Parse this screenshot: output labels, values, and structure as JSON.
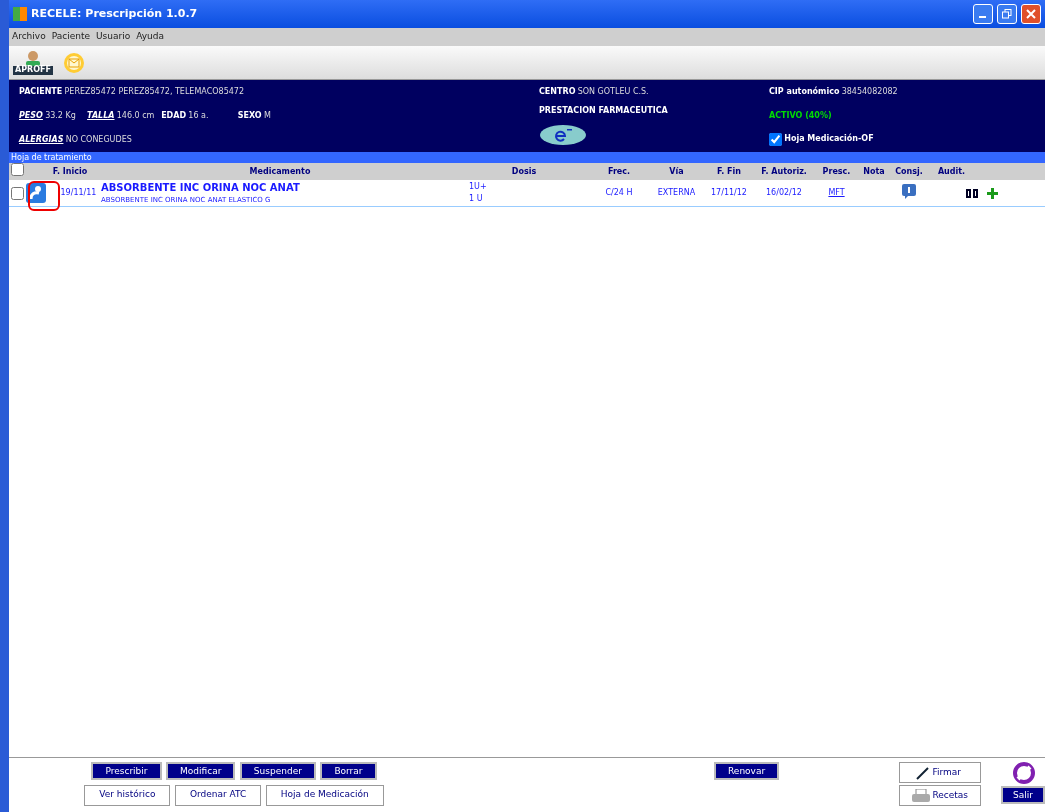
{
  "window": {
    "title": "RECELE: Prescripción 1.0.7"
  },
  "menu": [
    "Archivo",
    "Paciente",
    "Usuario",
    "Ayuda"
  ],
  "toolbar": {
    "badge": "APROFF"
  },
  "patient": {
    "paciente_label": "PACIENTE",
    "paciente": "PEREZ85472 PEREZ85472, TELEMACO85472",
    "peso_label": "PESO",
    "peso": "33.2 Kg",
    "talla_label": "TALLA",
    "talla": "146.0 cm",
    "edad_label": "EDAD",
    "edad": "16 a.",
    "sexo_label": "SEXO",
    "sexo": "M",
    "alergias_label": "ALERGIAS",
    "alergias": "NO CONEGUDES",
    "centro_label": "CENTRO",
    "centro": "SON GOTLEU C.S.",
    "prestacion": "PRESTACION FARMACEUTICA",
    "cip_label": "CIP autonómico",
    "cip": "38454082082",
    "activo": "ACTIVO (40%)",
    "hoja_label": "Hoja Medicación-OF",
    "hoja_checked": true
  },
  "section_title": "Hoja de tratamiento",
  "table": {
    "select_all_checked": false,
    "columns": [
      "F. Inicio",
      "Medicamento",
      "Dosis",
      "Frec.",
      "Vía",
      "F. Fin",
      "F. Autoriz.",
      "Presc.",
      "Nota",
      "Consj.",
      "Audit."
    ],
    "rows": [
      {
        "checked": false,
        "f_inicio": "19/11/11",
        "medicamento": "ABSORBENTE INC ORINA NOC ANAT",
        "detalle": "ABSORBENTE INC ORINA NOC ANAT ELASTICO G",
        "dosis": [
          "1U+",
          "1 U"
        ],
        "frec": "C/24 H",
        "via": "EXTERNA",
        "f_fin": "17/11/12",
        "f_autoriz": "16/02/12",
        "presc": "MFT"
      }
    ]
  },
  "buttons_row1": [
    "Prescribir",
    "Modificar",
    "Suspender",
    "Borrar"
  ],
  "buttons_row2": [
    "Ver histórico",
    "Ordenar ATC",
    "Hoja de Medicación"
  ],
  "renovar": "Renovar",
  "firmar": "Firmar",
  "recetas": "Recetas",
  "salir": "Salir"
}
